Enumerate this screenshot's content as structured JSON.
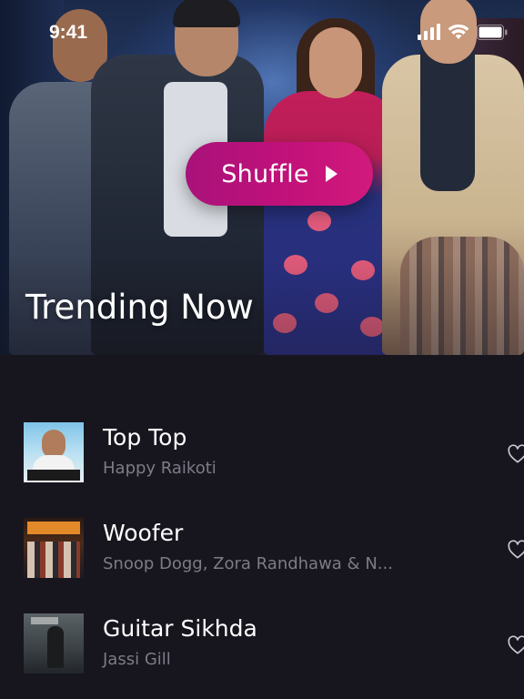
{
  "status_bar": {
    "time": "9:41",
    "icons": [
      "cellular-signal-icon",
      "wifi-icon",
      "battery-icon"
    ]
  },
  "hero": {
    "shuffle_label": "Shuffle",
    "section_title": "Trending Now"
  },
  "tracks": [
    {
      "title": "Top Top",
      "artist": "Happy Raikoti",
      "icon": "heart-icon"
    },
    {
      "title": "Woofer",
      "artist": "Snoop Dogg, Zora Randhawa & N...",
      "icon": "heart-icon"
    },
    {
      "title": "Guitar Sikhda",
      "artist": "Jassi Gill",
      "icon": "heart-icon"
    }
  ],
  "colors": {
    "background": "#17161f",
    "accent": "#c2117a",
    "secondary_text": "#7d7c86"
  }
}
